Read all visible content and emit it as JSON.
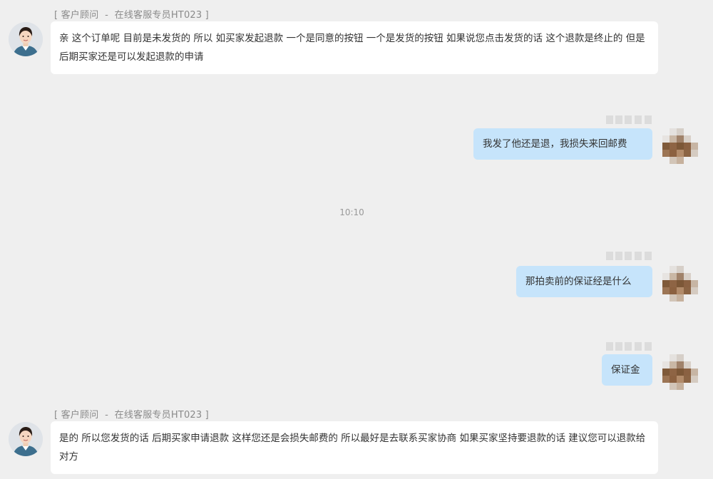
{
  "colors": {
    "background": "#efefef",
    "agent_bubble": "#ffffff",
    "user_bubble": "#c6e4fb",
    "label": "#8a8a8a"
  },
  "messages": [
    {
      "type": "agent",
      "sender_label": "[ 客户顾问  -  在线客服专员HT023 ]",
      "avatar": "agent-avatar",
      "text": "亲 这个订单呢 目前是未发货的 所以 如买家发起退款 一个是同意的按钮 一个是发货的按钮 如果说您点击发货的话 这个退款是终止的 但是后期买家还是可以发起退款的申请"
    },
    {
      "type": "user",
      "avatar": "user-avatar-pixelated",
      "text": "我发了他还是退，我损失来回邮费"
    },
    {
      "type": "time",
      "text": "10:10"
    },
    {
      "type": "user",
      "avatar": "user-avatar-pixelated",
      "text": "那拍卖前的保证经是什么"
    },
    {
      "type": "user",
      "avatar": "user-avatar-pixelated",
      "text": "保证金"
    },
    {
      "type": "agent",
      "sender_label": "[ 客户顾问  -  在线客服专员HT023 ]",
      "avatar": "agent-avatar",
      "text": "是的 所以您发货的话 后期买家申请退款 这样您还是会损失邮费的 所以最好是去联系买家协商 如果买家坚持要退款的话 建议您可以退款给对方"
    }
  ]
}
